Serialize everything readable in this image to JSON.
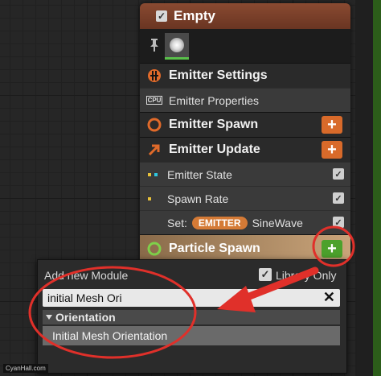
{
  "node": {
    "title": "Empty",
    "sections": {
      "emitter_settings": "Emitter Settings",
      "emitter_properties": "Emitter Properties",
      "emitter_spawn": "Emitter Spawn",
      "emitter_update": "Emitter Update",
      "emitter_state": "Emitter State",
      "spawn_rate": "Spawn Rate",
      "set_label": "Set:",
      "set_badge": "EMITTER",
      "set_value": "SineWave",
      "particle_spawn": "Particle Spawn"
    },
    "cpu_label": "CPU",
    "plus_symbol": "+",
    "check_symbol": "✓"
  },
  "popup": {
    "title": "Add new Module",
    "library_only_label": "Library Only",
    "search_value": "initial Mesh Ori",
    "clear_symbol": "✕",
    "category": "Orientation",
    "result": "Initial Mesh Orientation"
  },
  "watermark": "CyanHall.com",
  "colors": {
    "header": "#7a3f29",
    "orange_button": "#d86a2a",
    "green_button": "#4ca12c",
    "annotation_red": "#e0302a"
  }
}
